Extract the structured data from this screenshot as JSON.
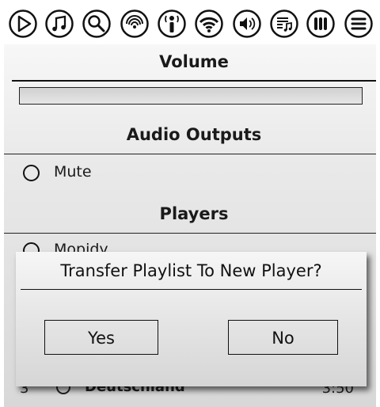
{
  "toolbar": {
    "buttons": [
      {
        "icon": "play-icon"
      },
      {
        "icon": "music-note-icon"
      },
      {
        "icon": "search-icon"
      },
      {
        "icon": "podcast-icon"
      },
      {
        "icon": "radio-tower-icon"
      },
      {
        "icon": "wifi-icon"
      },
      {
        "icon": "volume-icon"
      },
      {
        "icon": "playlist-icon"
      },
      {
        "icon": "columns-icon"
      },
      {
        "icon": "menu-icon"
      }
    ]
  },
  "volume": {
    "heading": "Volume",
    "level": 0.0
  },
  "audio_outputs": {
    "heading": "Audio Outputs",
    "items": [
      {
        "label": "Mute",
        "selected": false
      }
    ]
  },
  "players": {
    "heading": "Players",
    "items": [
      {
        "label": "Mopidy",
        "selected": false
      }
    ]
  },
  "playlist_row": {
    "number": "3",
    "title": "Deutschland",
    "time": "3:50"
  },
  "dialog": {
    "title": "Transfer Playlist To New Player?",
    "yes_label": "Yes",
    "no_label": "No"
  }
}
